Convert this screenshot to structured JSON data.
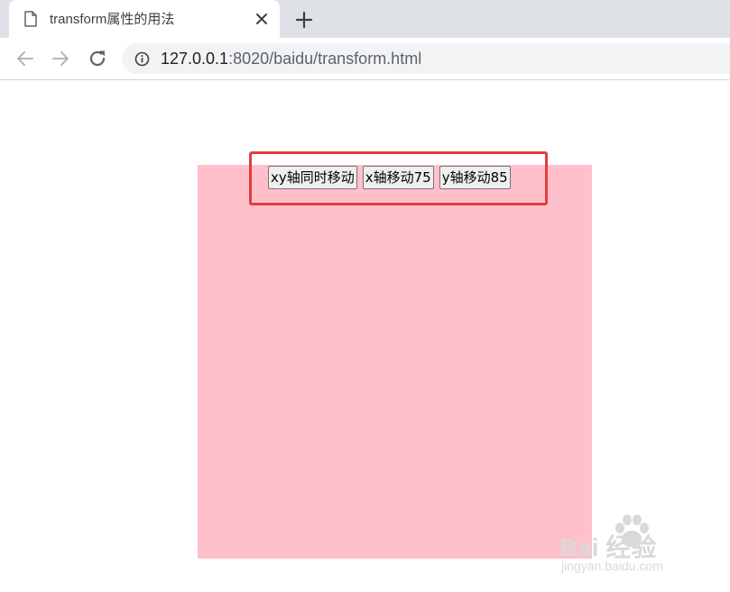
{
  "browser": {
    "tab": {
      "title": "transform属性的用法",
      "favicon": "page-icon",
      "close_icon": "close-icon"
    },
    "new_tab_icon": "plus-icon",
    "toolbar": {
      "back_icon": "arrow-left-icon",
      "forward_icon": "arrow-right-icon",
      "reload_icon": "reload-icon",
      "info_icon": "info-icon",
      "url_host": "127.0.0.1",
      "url_rest": ":8020/baidu/transform.html"
    }
  },
  "page": {
    "box_color": "#ffc0cb",
    "highlight_color": "#e23d3d",
    "buttons": [
      {
        "label": "xy轴同时移动"
      },
      {
        "label": "x轴移动75"
      },
      {
        "label": "y轴移动85"
      }
    ]
  },
  "watermark": {
    "logo_text": "Bai  经验",
    "domain": "jingyan.baidu.com"
  }
}
